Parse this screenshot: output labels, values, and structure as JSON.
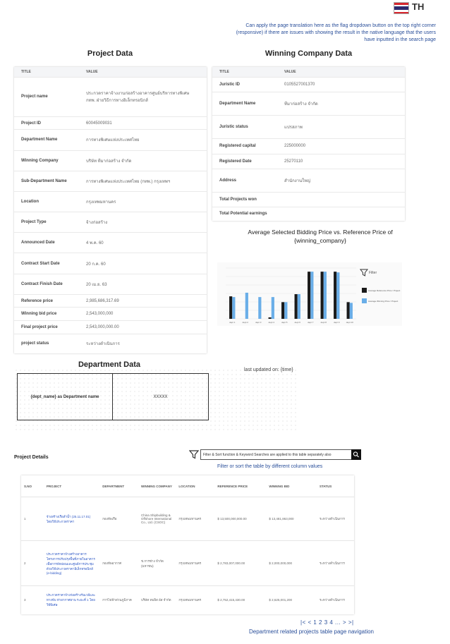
{
  "header": {
    "language": "TH",
    "note": "Can apply the page translation here as the flag dropdown button on the top right corner (responsive) if there are issues with showing the result in the native language that the users have inputted in the search page"
  },
  "project_data": {
    "title": "Project Data",
    "col_title": "TITLE",
    "col_value": "VALUE",
    "rows": [
      {
        "k": "Project name",
        "v": "ประกวดราคาจ้างงานก่อสร้างอาคารศูนย์บริหารทางพิเศษ กทพ. ฝ่ายวิธีการทางอิเล็กทรอนิกส์"
      },
      {
        "k": "Project ID",
        "v": "60045009031"
      },
      {
        "k": "Department Name",
        "v": "การทางพิเศษแห่งประเทศไทย"
      },
      {
        "k": "Winning Company",
        "v": "บริษัท ทีมาก่อสร้าง จำกัด"
      },
      {
        "k": "Sub-Department Name",
        "v": "การทางพิเศษแห่งประเทศไทย (กทพ.) กรุงเทพฯ"
      },
      {
        "k": "Location",
        "v": "กรุงเทพมหานคร"
      },
      {
        "k": "Project Type",
        "v": "จ้างก่อสร้าง"
      },
      {
        "k": "Announced Date",
        "v": "4 พ.ค. 60"
      },
      {
        "k": "Contract Start Date",
        "v": "20 ก.ค. 60"
      },
      {
        "k": "Contract Finish Date",
        "v": "20 เม.ย. 63"
      },
      {
        "k": "Reference price",
        "v": "2,985,686,317.69"
      },
      {
        "k": "Winning bid price",
        "v": "2,543,000,000"
      },
      {
        "k": "Final project price",
        "v": "2,543,000,000.00"
      },
      {
        "k": "project status",
        "v": "ระหว่างดำเนินการ"
      }
    ]
  },
  "company_data": {
    "title": "Winning Company Data",
    "col_title": "TITLE",
    "col_value": "VALUE",
    "rows": [
      {
        "k": "Juristic ID",
        "v": "0105527001370"
      },
      {
        "k": "Department Name",
        "v": "ทีมาก่อสร้าง จำกัด"
      },
      {
        "k": "Juristic status",
        "v": "แปรสภาพ"
      },
      {
        "k": "Registered capital",
        "v": "225000000"
      },
      {
        "k": "Registered Date",
        "v": "25270110"
      },
      {
        "k": "Address",
        "v": "สำนักงานใหญ่"
      },
      {
        "k": "Total Projects won",
        "v": ""
      },
      {
        "k": "Total Potential earnings",
        "v": ""
      }
    ]
  },
  "chart": {
    "title": "Average Selected Bidding Price vs. Reference Price of {winning_company}",
    "filter_label": "Filter",
    "colors": {
      "ref": "#1a1a1a",
      "win": "#6aaee8"
    }
  },
  "chart_data": {
    "type": "bar",
    "categories": [
      "dept 1",
      "dept 2",
      "dept 3",
      "dept 4",
      "dept 5",
      "dept 6",
      "dept 7",
      "dept 8",
      "dept 9",
      "dept 10"
    ],
    "series": [
      {
        "name": "Average Reference Price / Project",
        "values": [
          62,
          0,
          0,
          4,
          46,
          68,
          130,
          130,
          130,
          46
        ]
      },
      {
        "name": "Average Winning Price / Project",
        "values": [
          60,
          72,
          60,
          60,
          46,
          68,
          130,
          130,
          128,
          44
        ]
      }
    ],
    "ylim": [
      0,
      140
    ],
    "legend": "right",
    "grid": true
  },
  "department": {
    "title": "Department Data",
    "last_updated": "last updated on: {time}",
    "name_label": "{dept_name} as Department name",
    "value": "XXXXX"
  },
  "details": {
    "title": "Project Details",
    "filter_placeholder": "Filter & Sort function & Keyword Searches are applied to this table separately also",
    "filter_note": "Filter or sort the table by different column values",
    "columns": [
      "S.NO",
      "PROJECT",
      "DEPARTMENT",
      "WINNING COMPANY",
      "LOCATION",
      "REFERENCE PRICE",
      "WINNING BID",
      "STATUS"
    ],
    "rows": [
      [
        "1",
        "จ้างสร้างเรือลำน้ำ (25.11.17.01) โดยวิธีประกวดราคา",
        "กองทัพเรือ",
        "China Shipbuilding & Offshore International Co., Ltd. (CSOC)",
        "กรุงเทพมหานคร",
        "$ 13,500,000,000.00",
        "$ 13,481,863,000",
        "ระหว่างดำเนินการ"
      ],
      [
        "2",
        "ประกวดราคาจ้างสร้างอาคารโครงการปรับปรุงพื้นที่ภายในอาคารเพื่อการพักผ่อนและศูนย์การประชุม ด้วยวิธีประกวดราคาอิเล็กทรอนิกส์ (e-bidding)",
        "กองทัพอากาศ",
        "ช.การช่าง จำกัด (มหาชน)",
        "กรุงเทพมหานคร",
        "$ 2,783,007,000.00",
        "$ 2,000,000,000",
        "ระหว่างดำเนินการ"
      ],
      [
        "3",
        "ประกวดราคาจ้างก่อสร้างรันเวย์และทางขับ ท่าอากาศยาน ระยะที่ 1 โดยวิธีพิเศษ",
        "การไฟฟ้าส่วนภูมิภาค",
        "บริษัท ทมยิส อัส จำกัด",
        "กรุงเทพมหานคร",
        "$ 2,752,415,430.00",
        "$ 2,625,001,200",
        "ระหว่างดำเนินการ"
      ]
    ],
    "pagination": "|< < 1 2 3 4 ... > >|",
    "pagination_note": "Department related projects table page navigation"
  }
}
